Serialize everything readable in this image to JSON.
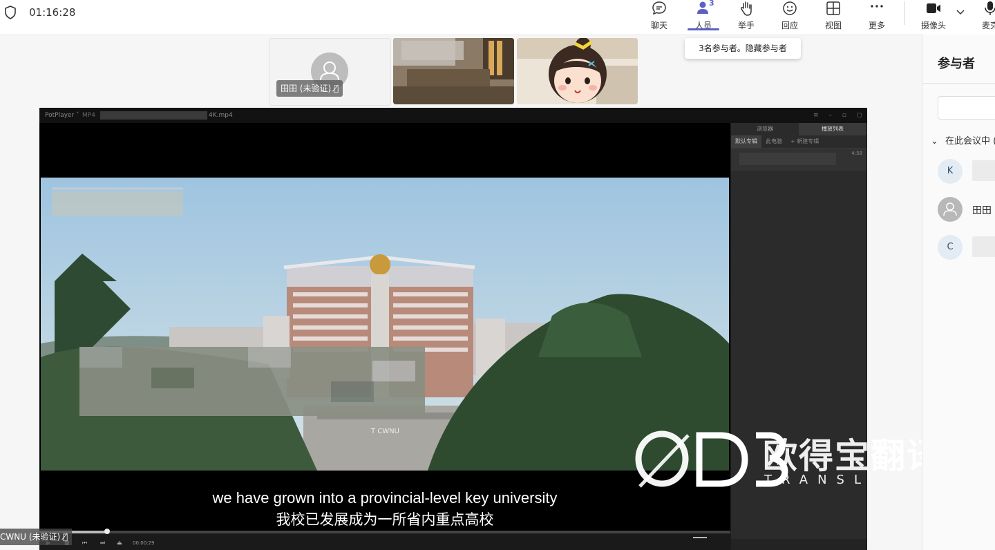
{
  "meeting": {
    "timer": "01:16:28",
    "accent_color": "#5b5fc7"
  },
  "toolbar": {
    "items": [
      {
        "label": "聊天",
        "icon": "chat-icon"
      },
      {
        "label": "人员",
        "icon": "people-icon",
        "count": "3"
      },
      {
        "label": "举手",
        "icon": "raise-hand-icon"
      },
      {
        "label": "回应",
        "icon": "emoji-icon"
      },
      {
        "label": "视图",
        "icon": "grid-view-icon"
      },
      {
        "label": "更多",
        "icon": "more-icon"
      },
      {
        "label": "摄像头",
        "icon": "camera-icon"
      },
      {
        "label": "麦克",
        "icon": "mic-icon"
      }
    ],
    "tooltip": "3名参与者。隐藏参与者"
  },
  "gallery": {
    "tile1_name": "田田 (未验证)"
  },
  "player": {
    "app_name": "PotPlayer ˅",
    "format": "MP4",
    "filename": "4K.mp4",
    "playlist_tabs": [
      "浏览器",
      "播放列表"
    ],
    "playlist_subtabs": [
      "默认专辑",
      "此电脑",
      "+ 新建专辑"
    ],
    "playlist_duration": "4:58",
    "current_time": "00:00:29",
    "subtitle_en": "we have grown into a provincial-level key university",
    "subtitle_cn": "我校已发展成为一所省内重点高校",
    "sign_text": "T  CWNU"
  },
  "watermark": {
    "cn": "欧得宝翻译",
    "en": "TRANSL"
  },
  "name_chip": "CWNU (未验证)",
  "panel": {
    "title": "参与者",
    "section": "在此会议中 (",
    "participants": [
      {
        "initial": "K",
        "name": ""
      },
      {
        "initial": "",
        "name": "田田"
      },
      {
        "initial": "C",
        "name": ""
      }
    ]
  }
}
